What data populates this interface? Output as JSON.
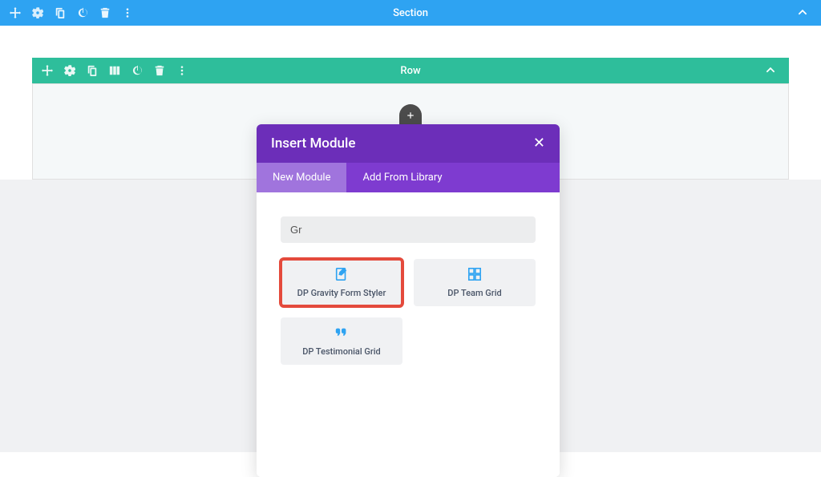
{
  "section": {
    "title": "Section"
  },
  "row": {
    "title": "Row"
  },
  "modal": {
    "title": "Insert Module",
    "tabs": {
      "new": "New Module",
      "library": "Add From Library"
    },
    "search": {
      "value": "Gr"
    },
    "modules": {
      "gravity": "DP Gravity Form Styler",
      "teamgrid": "DP Team Grid",
      "testimonial": "DP Testimonial Grid"
    }
  }
}
